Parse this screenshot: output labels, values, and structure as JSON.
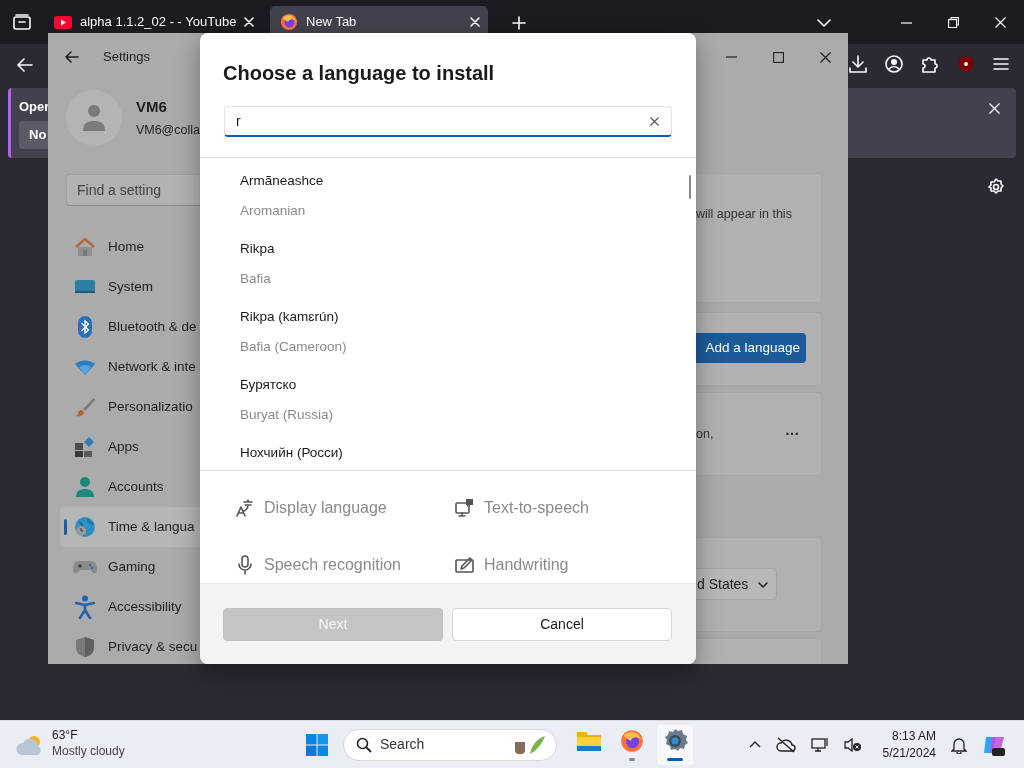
{
  "browser": {
    "tabs": [
      {
        "title": "alpha 1.1.2_02 - - YouTube",
        "kind": "video",
        "selected": false
      },
      {
        "title": "New Tab",
        "kind": "firefox",
        "selected": true
      }
    ],
    "notification": {
      "title": "Oper",
      "button": "No"
    }
  },
  "settings_window": {
    "title": "Settings",
    "user": {
      "name": "VM6",
      "email": "VM6@colla"
    },
    "search": {
      "placeholder": "Find a setting"
    },
    "nav": [
      {
        "label": "Home",
        "kind": "home",
        "selected": false
      },
      {
        "label": "System",
        "kind": "system",
        "selected": false
      },
      {
        "label": "Bluetooth & de",
        "kind": "bluetooth",
        "selected": false
      },
      {
        "label": "Network & inte",
        "kind": "network",
        "selected": false
      },
      {
        "label": "Personalizatio",
        "kind": "brush",
        "selected": false
      },
      {
        "label": "Apps",
        "kind": "apps",
        "selected": false
      },
      {
        "label": "Accounts",
        "kind": "person",
        "selected": false
      },
      {
        "label": "Time & langua",
        "kind": "globe",
        "selected": true
      },
      {
        "label": "Gaming",
        "kind": "gamepad",
        "selected": false
      },
      {
        "label": "Accessibility",
        "kind": "accessibility",
        "selected": false
      },
      {
        "label": "Privacy & secu",
        "kind": "shield",
        "selected": false
      }
    ],
    "content": {
      "description": "will appear in this",
      "add_button": "Add a language",
      "language_note": "on,",
      "more": "···",
      "region_value": "d States"
    }
  },
  "dialog": {
    "title": "Choose a language to install",
    "search": {
      "value": "r"
    },
    "languages": [
      {
        "name": "Armãneashce",
        "english": "Aromanian"
      },
      {
        "name": "Rikpa",
        "english": "Bafia"
      },
      {
        "name": "Rikpa (kamɛrún)",
        "english": "Bafia (Cameroon)"
      },
      {
        "name": "Бурятско",
        "english": "Buryat (Russia)"
      },
      {
        "name": "Нохчийн (Росси)"
      }
    ],
    "features": [
      {
        "label": "Display language",
        "kind": "font"
      },
      {
        "label": "Text-to-speech",
        "kind": "speech"
      },
      {
        "label": "Speech recognition",
        "kind": "mic"
      },
      {
        "label": "Handwriting",
        "kind": "pen"
      }
    ],
    "buttons": [
      {
        "label": "Next",
        "kind": "primary",
        "disabled": true
      },
      {
        "label": "Cancel",
        "kind": "secondary",
        "disabled": false
      }
    ]
  },
  "taskbar": {
    "weather": {
      "temperature": "63°F",
      "condition": "Mostly cloudy"
    },
    "search": {
      "placeholder": "Search"
    },
    "apps": [
      {
        "kind": "folder",
        "running": false,
        "active": false
      },
      {
        "kind": "firefox",
        "running": true,
        "active": false
      },
      {
        "kind": "settings",
        "running": true,
        "active": true
      }
    ],
    "clock": {
      "time": "8:13 AM",
      "date": "5/21/2024"
    }
  }
}
